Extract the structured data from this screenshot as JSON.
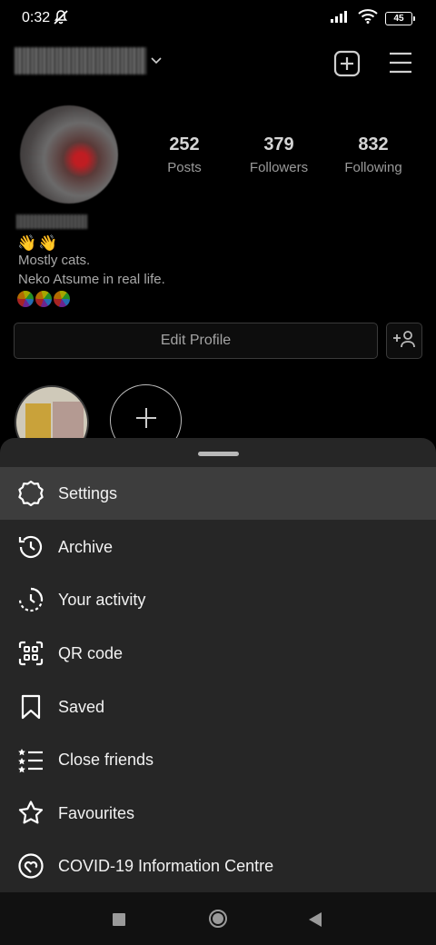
{
  "status_bar": {
    "time": "0:32",
    "battery": "45",
    "icons": [
      "mute-icon",
      "signal-icon",
      "wifi-icon",
      "battery-icon"
    ]
  },
  "header": {
    "icons": [
      "chevron-down-icon",
      "new-post-icon",
      "hamburger-menu-icon"
    ]
  },
  "profile": {
    "stats": [
      {
        "value": "252",
        "label": "Posts"
      },
      {
        "value": "379",
        "label": "Followers"
      },
      {
        "value": "832",
        "label": "Following"
      }
    ],
    "bio_emoji": "👋👋",
    "bio_lines": [
      "Mostly cats.",
      "Neko Atsume in real life."
    ],
    "edit_profile_label": "Edit Profile"
  },
  "sheet": {
    "items": [
      {
        "label": "Settings",
        "icon": "settings-icon"
      },
      {
        "label": "Archive",
        "icon": "archive-icon"
      },
      {
        "label": "Your activity",
        "icon": "activity-icon"
      },
      {
        "label": "QR code",
        "icon": "qr-code-icon"
      },
      {
        "label": "Saved",
        "icon": "bookmark-icon"
      },
      {
        "label": "Close friends",
        "icon": "close-friends-icon"
      },
      {
        "label": "Favourites",
        "icon": "star-icon"
      },
      {
        "label": "COVID-19 Information Centre",
        "icon": "covid-info-icon"
      }
    ]
  },
  "colors": {
    "background": "#000000",
    "sheet": "#262626",
    "active_row": "#3d3d3d",
    "text": "#f2f2f2"
  }
}
